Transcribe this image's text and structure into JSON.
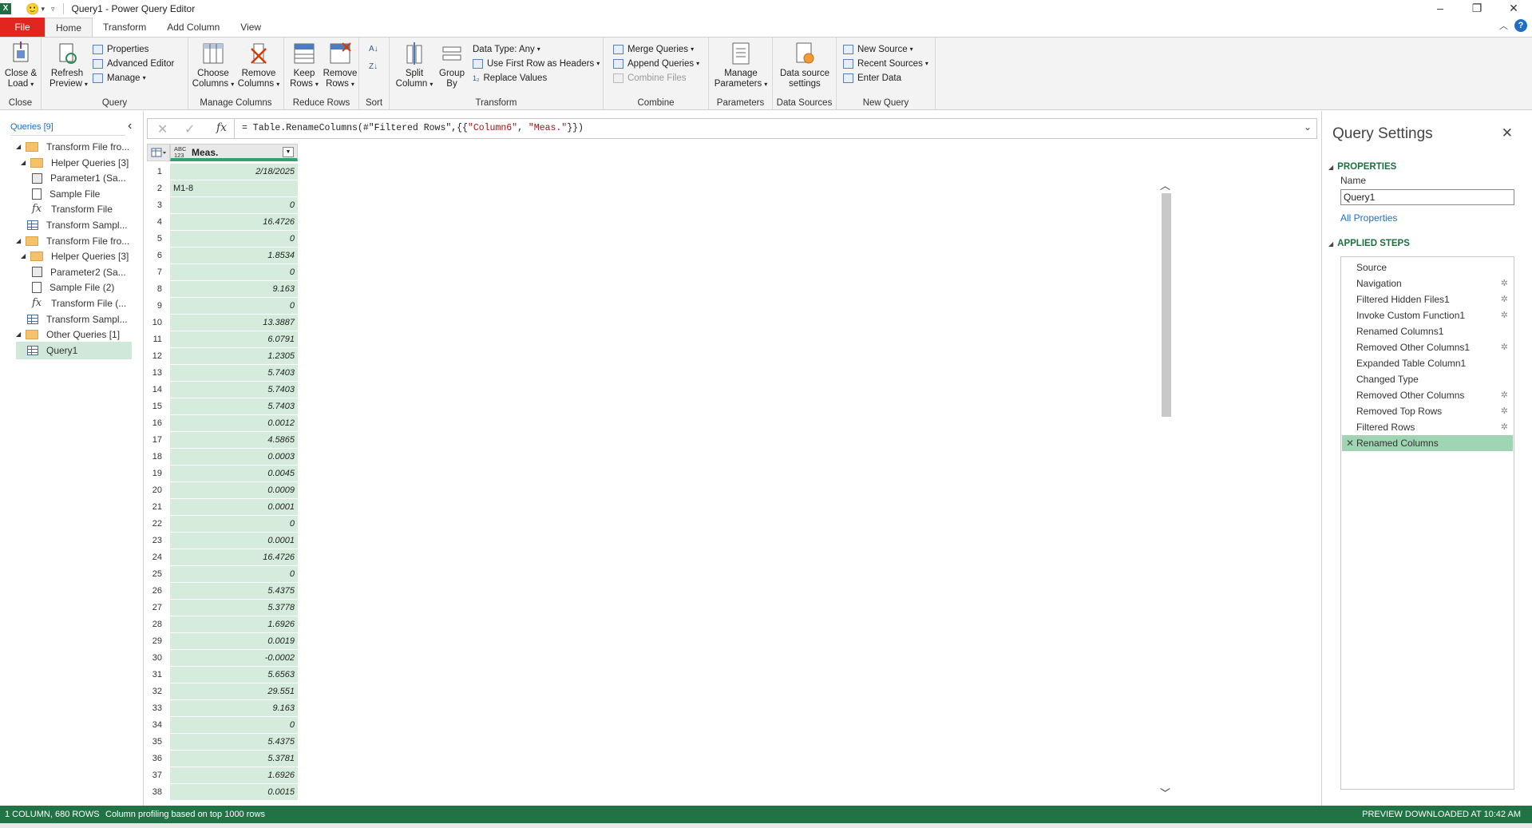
{
  "window": {
    "title": "Query1 - Power Query Editor",
    "app_icon": "X",
    "smiley": "🙂"
  },
  "tabs": [
    "File",
    "Home",
    "Transform",
    "Add Column",
    "View"
  ],
  "ribbon": {
    "close": {
      "label1": "Close &",
      "label2": "Load",
      "group": "Close"
    },
    "query": {
      "refresh1": "Refresh",
      "refresh2": "Preview",
      "properties": "Properties",
      "advanced": "Advanced Editor",
      "manage": "Manage",
      "group": "Query"
    },
    "manage_columns": {
      "choose1": "Choose",
      "choose2": "Columns",
      "remove1": "Remove",
      "remove2": "Columns",
      "group": "Manage Columns"
    },
    "reduce_rows": {
      "keep1": "Keep",
      "keep2": "Rows",
      "remove1": "Remove",
      "remove2": "Rows",
      "group": "Reduce Rows"
    },
    "sort": {
      "group": "Sort"
    },
    "transform": {
      "split1": "Split",
      "split2": "Column",
      "group1": "Group",
      "group2": "By",
      "datatype": "Data Type: Any",
      "firstrow": "Use First Row as Headers",
      "replace": "Replace Values",
      "group": "Transform"
    },
    "combine": {
      "merge": "Merge Queries",
      "append": "Append Queries",
      "combine_files": "Combine Files",
      "group": "Combine"
    },
    "parameters": {
      "label1": "Manage",
      "label2": "Parameters",
      "group": "Parameters"
    },
    "data_sources": {
      "label1": "Data source",
      "label2": "settings",
      "group": "Data Sources"
    },
    "new_query": {
      "new_source": "New Source",
      "recent": "Recent Sources",
      "enter": "Enter Data",
      "group": "New Query"
    }
  },
  "queries_pane": {
    "header": "Queries [9]",
    "items": [
      {
        "label": "Transform File fro...",
        "type": "folder",
        "level": 0
      },
      {
        "label": "Helper Queries [3]",
        "type": "folder",
        "level": 1
      },
      {
        "label": "Parameter1 (Sa...",
        "type": "param",
        "level": 2
      },
      {
        "label": "Sample File",
        "type": "doc",
        "level": 2
      },
      {
        "label": "Transform File",
        "type": "fx",
        "level": 2
      },
      {
        "label": "Transform Sampl...",
        "type": "table",
        "level": 1
      },
      {
        "label": "Transform File fro...",
        "type": "folder",
        "level": 0
      },
      {
        "label": "Helper Queries [3]",
        "type": "folder",
        "level": 1
      },
      {
        "label": "Parameter2 (Sa...",
        "type": "param",
        "level": 2
      },
      {
        "label": "Sample File (2)",
        "type": "doc",
        "level": 2
      },
      {
        "label": "Transform File (...",
        "type": "fx",
        "level": 2
      },
      {
        "label": "Transform Sampl...",
        "type": "table",
        "level": 1
      },
      {
        "label": "Other Queries [1]",
        "type": "folder",
        "level": 0
      },
      {
        "label": "Query1",
        "type": "table",
        "level": 1,
        "selected": true
      }
    ]
  },
  "formula_bar": {
    "prefix": "= Table.RenameColumns(#\"Filtered Rows\",{{",
    "str1": "\"Column6\"",
    "mid": ", ",
    "str2": "\"Meas.\"",
    "suffix": "}})"
  },
  "grid": {
    "column_type": "ABC\n123",
    "column_name": "Meas.",
    "rows": [
      {
        "n": "1",
        "v": "2/18/2025",
        "kind": "num"
      },
      {
        "n": "2",
        "v": "M1-8",
        "kind": "text"
      },
      {
        "n": "3",
        "v": "0",
        "kind": "num"
      },
      {
        "n": "4",
        "v": "16.4726",
        "kind": "num"
      },
      {
        "n": "5",
        "v": "0",
        "kind": "num"
      },
      {
        "n": "6",
        "v": "1.8534",
        "kind": "num"
      },
      {
        "n": "7",
        "v": "0",
        "kind": "num"
      },
      {
        "n": "8",
        "v": "9.163",
        "kind": "num"
      },
      {
        "n": "9",
        "v": "0",
        "kind": "num"
      },
      {
        "n": "10",
        "v": "13.3887",
        "kind": "num"
      },
      {
        "n": "11",
        "v": "6.0791",
        "kind": "num"
      },
      {
        "n": "12",
        "v": "1.2305",
        "kind": "num"
      },
      {
        "n": "13",
        "v": "5.7403",
        "kind": "num"
      },
      {
        "n": "14",
        "v": "5.7403",
        "kind": "num"
      },
      {
        "n": "15",
        "v": "5.7403",
        "kind": "num"
      },
      {
        "n": "16",
        "v": "0.0012",
        "kind": "num"
      },
      {
        "n": "17",
        "v": "4.5865",
        "kind": "num"
      },
      {
        "n": "18",
        "v": "0.0003",
        "kind": "num"
      },
      {
        "n": "19",
        "v": "0.0045",
        "kind": "num"
      },
      {
        "n": "20",
        "v": "0.0009",
        "kind": "num"
      },
      {
        "n": "21",
        "v": "0.0001",
        "kind": "num"
      },
      {
        "n": "22",
        "v": "0",
        "kind": "num"
      },
      {
        "n": "23",
        "v": "0.0001",
        "kind": "num"
      },
      {
        "n": "24",
        "v": "16.4726",
        "kind": "num"
      },
      {
        "n": "25",
        "v": "0",
        "kind": "num"
      },
      {
        "n": "26",
        "v": "5.4375",
        "kind": "num"
      },
      {
        "n": "27",
        "v": "5.3778",
        "kind": "num"
      },
      {
        "n": "28",
        "v": "1.6926",
        "kind": "num"
      },
      {
        "n": "29",
        "v": "0.0019",
        "kind": "num"
      },
      {
        "n": "30",
        "v": "-0.0002",
        "kind": "num"
      },
      {
        "n": "31",
        "v": "5.6563",
        "kind": "num"
      },
      {
        "n": "32",
        "v": "29.551",
        "kind": "num"
      },
      {
        "n": "33",
        "v": "9.163",
        "kind": "num"
      },
      {
        "n": "34",
        "v": "0",
        "kind": "num"
      },
      {
        "n": "35",
        "v": "5.4375",
        "kind": "num"
      },
      {
        "n": "36",
        "v": "5.3781",
        "kind": "num"
      },
      {
        "n": "37",
        "v": "1.6926",
        "kind": "num"
      },
      {
        "n": "38",
        "v": "0.0015",
        "kind": "num"
      }
    ]
  },
  "settings": {
    "title": "Query Settings",
    "properties_header": "PROPERTIES",
    "name_label": "Name",
    "name_value": "Query1",
    "all_properties": "All Properties",
    "steps_header": "APPLIED STEPS",
    "steps": [
      {
        "label": "Source",
        "gear": false
      },
      {
        "label": "Navigation",
        "gear": true
      },
      {
        "label": "Filtered Hidden Files1",
        "gear": true
      },
      {
        "label": "Invoke Custom Function1",
        "gear": true
      },
      {
        "label": "Renamed Columns1",
        "gear": false
      },
      {
        "label": "Removed Other Columns1",
        "gear": true
      },
      {
        "label": "Expanded Table Column1",
        "gear": false
      },
      {
        "label": "Changed Type",
        "gear": false
      },
      {
        "label": "Removed Other Columns",
        "gear": true
      },
      {
        "label": "Removed Top Rows",
        "gear": true
      },
      {
        "label": "Filtered Rows",
        "gear": true
      },
      {
        "label": "Renamed Columns",
        "gear": false,
        "selected": true
      }
    ]
  },
  "status": {
    "left1": "1 COLUMN, 680 ROWS",
    "left2": "Column profiling based on top 1000 rows",
    "right": "PREVIEW DOWNLOADED AT 10:42 AM"
  },
  "colors": {
    "accent_green": "#217346",
    "selection_green": "#d5ecdc",
    "file_red": "#e0261f"
  }
}
